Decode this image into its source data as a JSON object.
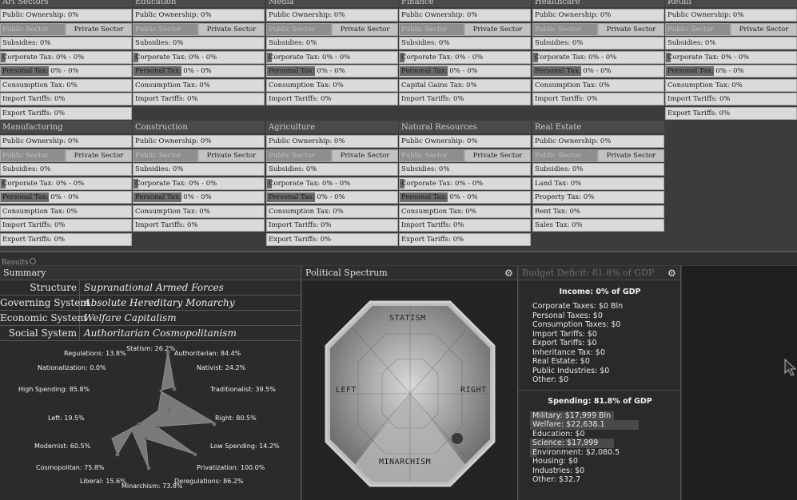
{
  "sectors_row1": [
    {
      "name": "Art Sectors",
      "public": "Public Ownership: 0%",
      "pub_sector": "Public Sector",
      "priv_sector": "Private Sector",
      "subsidies": "Subsidies: 0%",
      "corporate": "Corporate Tax: 0% - 0%",
      "personal": "Personal Tax: 0% - 0%",
      "consumption": "Consumption Tax: 0%",
      "import": "Import Tariffs: 0%",
      "export": "Export Tariffs: 0%"
    },
    {
      "name": "Education",
      "public": "Public Ownership: 0%",
      "pub_sector": "Public Sector",
      "priv_sector": "Private Sector",
      "subsidies": "Subsidies: 0%",
      "corporate": "Corporate Tax: 0% - 0%",
      "personal": "Personal Tax: 0% - 0%",
      "consumption": "Consumption Tax: 0%",
      "import": "Import Tariffs: 0%"
    },
    {
      "name": "Media",
      "public": "Public Ownership: 0%",
      "pub_sector": "Public Sector",
      "priv_sector": "Private Sector",
      "subsidies": "Subsidies: 0%",
      "corporate": "Corporate Tax: 0% - 0%",
      "personal": "Personal Tax: 0% - 0%",
      "consumption": "Consumption Tax: 0%",
      "import": "Import Tariffs: 0%"
    },
    {
      "name": "Finance",
      "public": "Public Ownership: 0%",
      "pub_sector": "Public Sector",
      "priv_sector": "Private Sector",
      "subsidies": "Subsidies: 0%",
      "corporate": "Corporate Tax: 0% - 0%",
      "personal": "Personal Tax: 0% - 0%",
      "consumption": "Capital Gains Tax: 0%",
      "import": "Import Tariffs: 0%"
    },
    {
      "name": "Healthcare",
      "public": "Public Ownership: 0%",
      "pub_sector": "Public Sector",
      "priv_sector": "Private Sector",
      "subsidies": "Subsidies: 0%",
      "corporate": "Corporate Tax: 0% - 0%",
      "personal": "Personal Tax: 0% - 0%",
      "consumption": "Consumption Tax: 0%",
      "import": "Import Tariffs: 0%"
    },
    {
      "name": "Retail",
      "public": "Public Ownership: 0%",
      "pub_sector": "Public Sector",
      "priv_sector": "Private Sector",
      "subsidies": "Subsidies: 0%",
      "corporate": "Corporate Tax: 0% - 0%",
      "personal": "Personal Tax: 0% - 0%",
      "consumption": "Consumption Tax: 0%",
      "import": "Import Tariffs: 0%",
      "export": "Export Tariffs: 0%"
    }
  ],
  "sectors_row2": [
    {
      "name": "Manufacturing",
      "public": "Public Ownership: 0%",
      "pub_sector": "Public Sector",
      "priv_sector": "Private Sector",
      "subsidies": "Subsidies: 0%",
      "corporate": "Corporate Tax: 0% - 0%",
      "personal": "Personal Tax: 0% - 0%",
      "consumption": "Consumption Tax: 0%",
      "import": "Import Tariffs: 0%",
      "export": "Export Tariffs: 0%"
    },
    {
      "name": "Construction",
      "public": "Public Ownership: 0%",
      "pub_sector": "Public Sector",
      "priv_sector": "Private Sector",
      "subsidies": "Subsidies: 0%",
      "corporate": "Corporate Tax: 0% - 0%",
      "personal": "Personal Tax: 0% - 0%",
      "consumption": "Consumption Tax: 0%",
      "import": "Import Tariffs: 0%"
    },
    {
      "name": "Agriculture",
      "public": "Public Ownership: 0%",
      "pub_sector": "Public Sector",
      "priv_sector": "Private Sector",
      "subsidies": "Subsidies: 0%",
      "corporate": "Corporate Tax: 0% - 0%",
      "personal": "Personal Tax: 0% - 0%",
      "consumption": "Consumption Tax: 0%",
      "import": "Import Tariffs: 0%",
      "export": "Export Tariffs: 0%"
    },
    {
      "name": "Natural Resources",
      "public": "Public Ownership: 0%",
      "pub_sector": "Public Sector",
      "priv_sector": "Private Sector",
      "subsidies": "Subsidies: 0%",
      "corporate": "Corporate Tax: 0% - 0%",
      "personal": "Personal Tax: 0% - 0%",
      "consumption": "Consumption Tax: 0%",
      "import": "Import Tariffs: 0%",
      "export": "Export Tariffs: 0%"
    },
    {
      "name": "Real Estate",
      "public": "Public Ownership: 0%",
      "pub_sector": "Public Sector",
      "priv_sector": "Private Sector",
      "subsidies": "Subsidies: 0%",
      "land": "Land Tax: 0%",
      "property": "Property Tax: 0%",
      "rent": "Rent Tax: 0%",
      "sales": "Sales Tax: 0%"
    }
  ],
  "results": {
    "label": "Results"
  },
  "summary": {
    "title": "Summary",
    "rows": [
      {
        "label": "Structure",
        "value": "Supranational Armed Forces"
      },
      {
        "label": "Governing System",
        "value": "Absolute Hereditary Monarchy"
      },
      {
        "label": "Economic System",
        "value": "Welfare Capitalism"
      },
      {
        "label": "Social System",
        "value": "Authoritarian Cosmopolitanism"
      }
    ]
  },
  "radar": [
    {
      "label": "Statism: 26.2%"
    },
    {
      "label": "Authoritarian: 84.4%"
    },
    {
      "label": "Nativist: 24.2%"
    },
    {
      "label": "Traditionalist: 39.5%"
    },
    {
      "label": "Right: 80.5%"
    },
    {
      "label": "Low Spending: 14.2%"
    },
    {
      "label": "Privatization: 100.0%"
    },
    {
      "label": "Deregulations: 86.2%"
    },
    {
      "label": "Minarchism: 73.8%"
    },
    {
      "label": "Liberal: 15.6%"
    },
    {
      "label": "Cosmopolitan: 75.8%"
    },
    {
      "label": "Modernist: 60.5%"
    },
    {
      "label": "Left: 19.5%"
    },
    {
      "label": "High Spending: 85.8%"
    },
    {
      "label": "Nationalization: 0.0%"
    },
    {
      "label": "Regulations: 13.8%"
    }
  ],
  "spectrum": {
    "title": "Political Spectrum",
    "top": "STATISM",
    "left": "LEFT",
    "right": "RIGHT",
    "bottom": "MINARCHISM"
  },
  "budget": {
    "title": "Budget Deficit: 81.8% of GDP",
    "income_title": "Income: 0% of GDP",
    "income": [
      "Corporate Taxes: $0 Bln",
      "Personal Taxes: $0",
      "Consumption Taxes: $0",
      "Import Tariffs: $0",
      "Export Tariffs: $0",
      "Inheritance Tax: $0",
      "Real Estate: $0",
      "Public Industries: $0",
      "Other: $0"
    ],
    "spending_title": "Spending: 81.8% of GDP",
    "spending": [
      {
        "label": "Military: $17,999 Bln",
        "share": 0.62
      },
      {
        "label": "Welfare: $22,638.1",
        "share": 0.8
      },
      {
        "label": "Education: $0",
        "share": 0
      },
      {
        "label": "Science: $17,999",
        "share": 0.62
      },
      {
        "label": "Environment: $2,080.5",
        "share": 0.05
      },
      {
        "label": "Housing: $0",
        "share": 0
      },
      {
        "label": "Industries: $0",
        "share": 0
      },
      {
        "label": "Other: $32.7",
        "share": 0
      }
    ]
  }
}
